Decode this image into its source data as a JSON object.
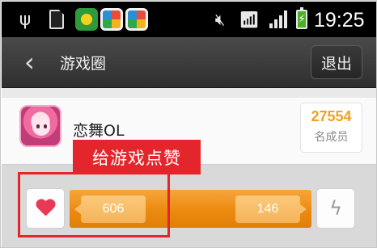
{
  "status_bar": {
    "time": "19:25",
    "icons": [
      "usb-icon",
      "sd-card-icon",
      "app-icon",
      "app-icon",
      "app-icon",
      "mute-icon",
      "wifi-icon",
      "signal-icon",
      "battery-charging-icon"
    ]
  },
  "header": {
    "title": "游戏圈",
    "back_icon": "chevron-left-icon",
    "exit_label": "退出"
  },
  "game": {
    "name": "恋舞OL",
    "member_count": "27554",
    "member_label": "名成员"
  },
  "annotation": {
    "label": "给游戏点赞",
    "color": "#e5252c"
  },
  "like_bar": {
    "like_count": "606",
    "other_count": "146",
    "like_icon": "heart-icon",
    "other_icon": "lightning-icon",
    "accent": "#ec8a10"
  }
}
